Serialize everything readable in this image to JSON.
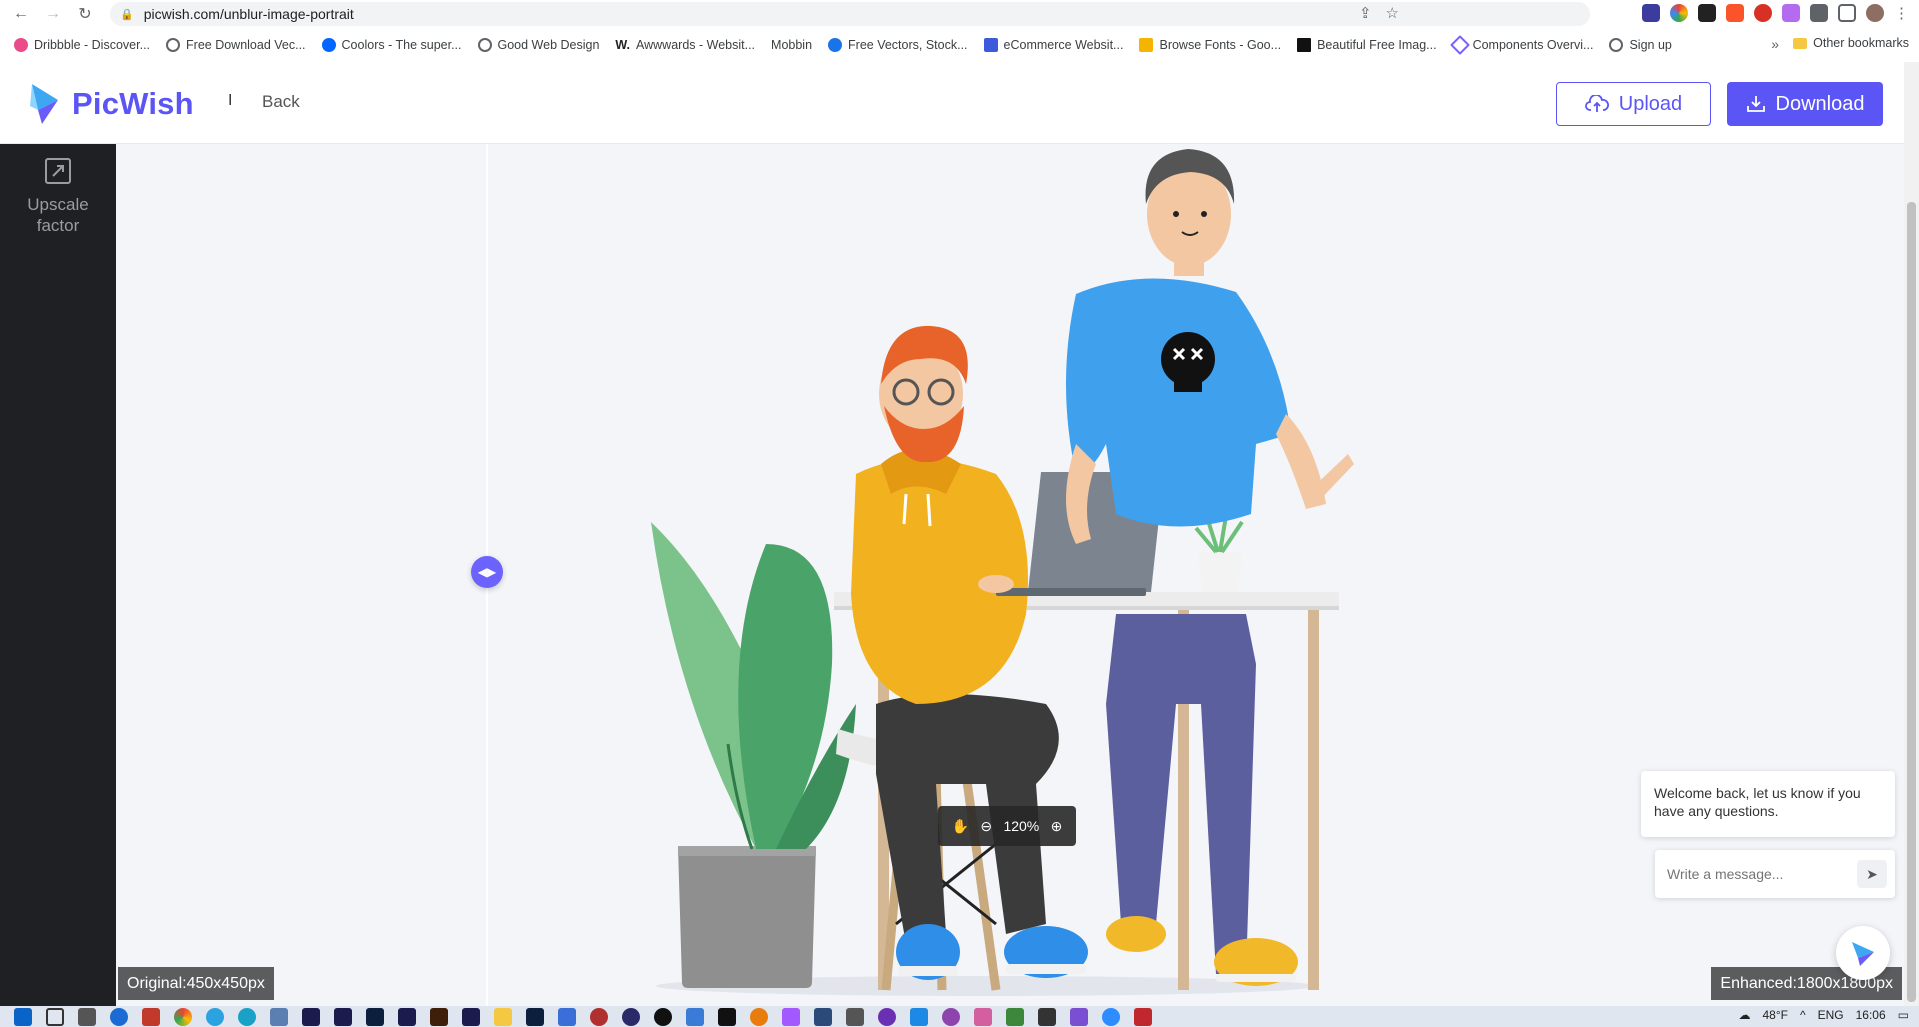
{
  "browser": {
    "url": "picwish.com/unblur-image-portrait",
    "bookmarks": [
      {
        "label": "Dribbble - Discover...",
        "color": "#ea4c89"
      },
      {
        "label": "Free Download Vec...",
        "color": "#5f6368"
      },
      {
        "label": "Coolors - The super...",
        "color": "#0066ff"
      },
      {
        "label": "Good Web Design",
        "color": "#5f6368"
      },
      {
        "label": "Awwwards - Websit...",
        "color": "#222222"
      },
      {
        "label": "Mobbin",
        "color": "#ffffff"
      },
      {
        "label": "Free Vectors, Stock...",
        "color": "#1a73e8"
      },
      {
        "label": "eCommerce Websit...",
        "color": "#3b5bdb"
      },
      {
        "label": "Browse Fonts - Goo...",
        "color": "#f4b400"
      },
      {
        "label": "Beautiful Free Imag...",
        "color": "#111111"
      },
      {
        "label": "Components Overvi...",
        "color": "#7b61ff"
      },
      {
        "label": "Sign up",
        "color": "#5f6368"
      }
    ],
    "more_symbol": "»",
    "other_bookmarks": "Other bookmarks"
  },
  "header": {
    "logo_text": "PicWish",
    "separator": "I",
    "back_label": "Back",
    "upload_label": "Upload",
    "download_label": "Download",
    "accent": "#5b55f6"
  },
  "sidebar": {
    "tool_label_line1": "Upscale",
    "tool_label_line2": "factor"
  },
  "canvas": {
    "zoom_level": "120%",
    "original_badge": "Original:450x450px",
    "enhanced_badge": "Enhanced:1800x1800px"
  },
  "chat": {
    "welcome_message": "Welcome back, let us know if you have any questions.",
    "input_placeholder": "Write a message..."
  },
  "taskbar": {
    "weather": "48°F",
    "language": "ENG",
    "time": "16:06"
  }
}
